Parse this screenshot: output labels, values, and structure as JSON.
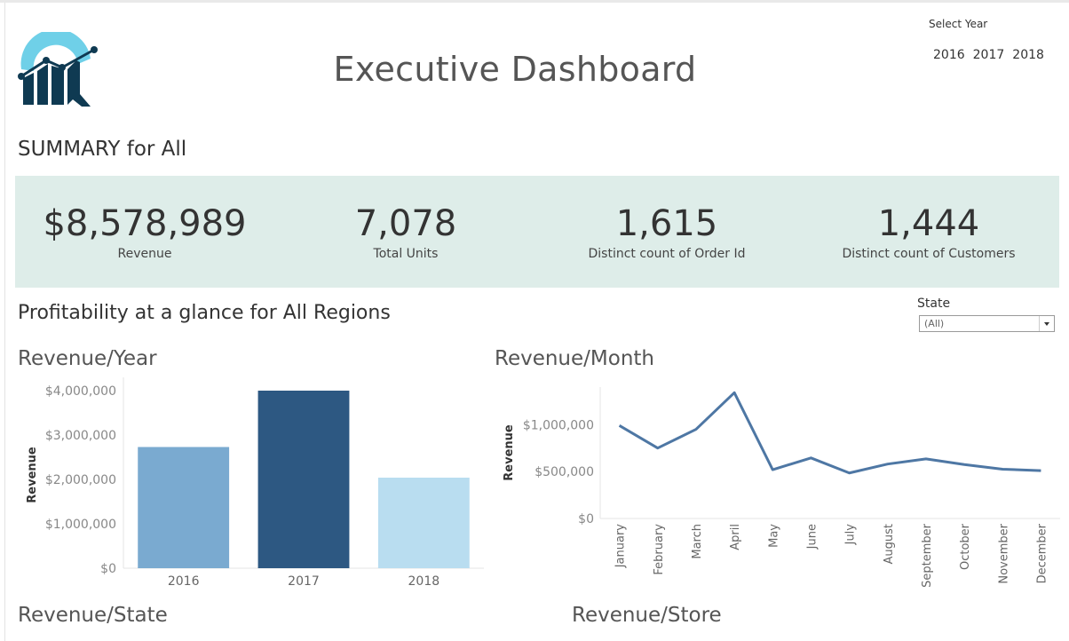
{
  "header": {
    "title": "Executive Dashboard",
    "year_selector_label": "Select Year",
    "year_options": [
      "2016",
      "2017",
      "2018"
    ]
  },
  "summary": {
    "title": "SUMMARY for  All",
    "kpis": [
      {
        "value": "$8,578,989",
        "label": "Revenue"
      },
      {
        "value": "7,078",
        "label": "Total Units"
      },
      {
        "value": "1,615",
        "label": "Distinct count of Order Id"
      },
      {
        "value": "1,444",
        "label": "Distinct count of Customers"
      }
    ]
  },
  "profitability": {
    "title": "Profitability at a glance for All Regions",
    "state_filter_label": "State",
    "state_filter_value": "(All)"
  },
  "sections": {
    "revenue_year": "Revenue/Year",
    "revenue_month": "Revenue/Month",
    "revenue_state": "Revenue/State",
    "revenue_store": "Revenue/Store"
  },
  "colors": {
    "kpi_band": "#deede9",
    "bar_2016": "#7aaad0",
    "bar_2017": "#2d5882",
    "bar_2018": "#b9ddf0",
    "line": "#4e77a4"
  },
  "chart_data": [
    {
      "type": "bar",
      "categories": [
        "2016",
        "2017",
        "2018"
      ],
      "values": [
        2730000,
        4000000,
        2040000
      ],
      "ylabel": "Revenue",
      "ylim": [
        0,
        4200000
      ],
      "yticks": [
        0,
        1000000,
        2000000,
        3000000,
        4000000
      ],
      "ytick_labels": [
        "$0",
        "$1,000,000",
        "$2,000,000",
        "$3,000,000",
        "$4,000,000"
      ],
      "bar_colors": [
        "#7aaad0",
        "#2d5882",
        "#b9ddf0"
      ],
      "grid": false
    },
    {
      "type": "line",
      "categories": [
        "January",
        "February",
        "March",
        "April",
        "May",
        "June",
        "July",
        "August",
        "September",
        "October",
        "November",
        "December"
      ],
      "values": [
        990000,
        750000,
        950000,
        1340000,
        520000,
        645000,
        485000,
        580000,
        635000,
        575000,
        525000,
        510000
      ],
      "ylabel": "Revenue",
      "ylim": [
        0,
        1400000
      ],
      "yticks": [
        0,
        500000,
        1000000
      ],
      "ytick_labels": [
        "$0",
        "$500,000",
        "$1,000,000"
      ],
      "grid": false
    }
  ]
}
